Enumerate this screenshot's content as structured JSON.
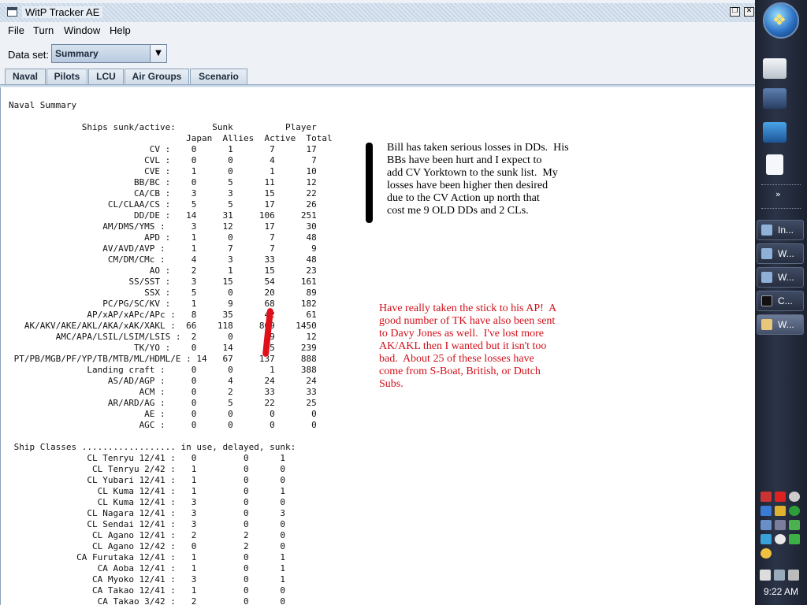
{
  "window": {
    "title": "WitP Tracker AE"
  },
  "menu": [
    "File",
    "Turn",
    "Window",
    "Help"
  ],
  "dataset": {
    "label": "Data set:",
    "value": "Summary"
  },
  "tabs": [
    "Naval",
    "Pilots",
    "LCU",
    "Air Groups",
    "Scenario"
  ],
  "report": {
    "summary_text": "Naval Summary\n\n              Ships sunk/active:       Sunk          Player\n                                  Japan  Allies  Active  Total\n                           CV :    0      1       7      17\n                          CVL :    0      0       4       7\n                          CVE :    1      0       1      10\n                        BB/BC :    0      5      11      12\n                        CA/CB :    3      3      15      22\n                   CL/CLAA/CS :    5      5      17      26\n                        DD/DE :   14     31     106     251\n                  AM/DMS/YMS :     3     12      17      30\n                          APD :    1      0       7      48\n                  AV/AVD/AVP :     1      7       7       9\n                   CM/DM/CMc :     4      3      33      48\n                           AO :    2      1      15      23\n                       SS/SST :    3     15      54     161\n                          SSX :    5      0      20      89\n                  PC/PG/SC/KV :    1      9      68     182\n               AP/xAP/xAPc/APc :   8     35      42      61\n   AK/AKV/AKE/AKL/AKA/xAK/XAKL :  66    118     869    1450\n         AMC/APA/LSIL/LSIM/LSIS :  2      0       9      12\n                        TK/YO :    0     14      65     239\n PT/PB/MGB/PF/YP/TB/MTB/ML/HDML/E : 14   67     137     888\n               Landing craft :     0      0       1     388\n                   AS/AD/AGP :     0      4      24      24\n                         ACM :     0      2      33      33\n                   AR/ARD/AG :     0      5      22      25\n                          AE :     0      0       0       0\n                         AGC :     0      0       0       0",
    "classes_text": " Ship Classes .................. in use, delayed, sunk:\n               CL Tenryu 12/41 :   0         0      1\n                CL Tenryu 2/42 :   1         0      0\n               CL Yubari 12/41 :   1         0      0\n                 CL Kuma 12/41 :   1         0      1\n                 CL Kuma 12/41 :   3         0      0\n               CL Nagara 12/41 :   3         0      3\n               CL Sendai 12/41 :   3         0      0\n                CL Agano 12/41 :   2         2      0\n                CL Agano 12/42 :   0         2      0\n             CA Furutaka 12/41 :   1         0      1\n                 CA Aoba 12/41 :   1         0      1\n                CA Myoko 12/41 :   3         0      1\n                CA Takao 12/41 :   1         0      0\n                 CA Takao 3/42 :   2         0      0"
  },
  "annotations": {
    "black": "Bill has taken serious losses in DDs.  His\nBBs have been hurt and I expect to\nadd CV Yorktown to the sunk list.  My\nlosses have been higher then desired\ndue to the CV Action up north that\ncost me 9 OLD DDs and 2 CLs.",
    "red": "Have really taken the stick to his AP!  A\ngood number of TK have also been sent\nto Davy Jones as well.  I've lost more\nAK/AKL then I wanted but it isn't too\nbad.  About 25 of these losses have\ncome from S-Boat, British, or Dutch\nSubs."
  },
  "taskbar": {
    "items": [
      "In...",
      "W...",
      "W...",
      "C...",
      "W..."
    ],
    "clock": "9:22 AM"
  }
}
